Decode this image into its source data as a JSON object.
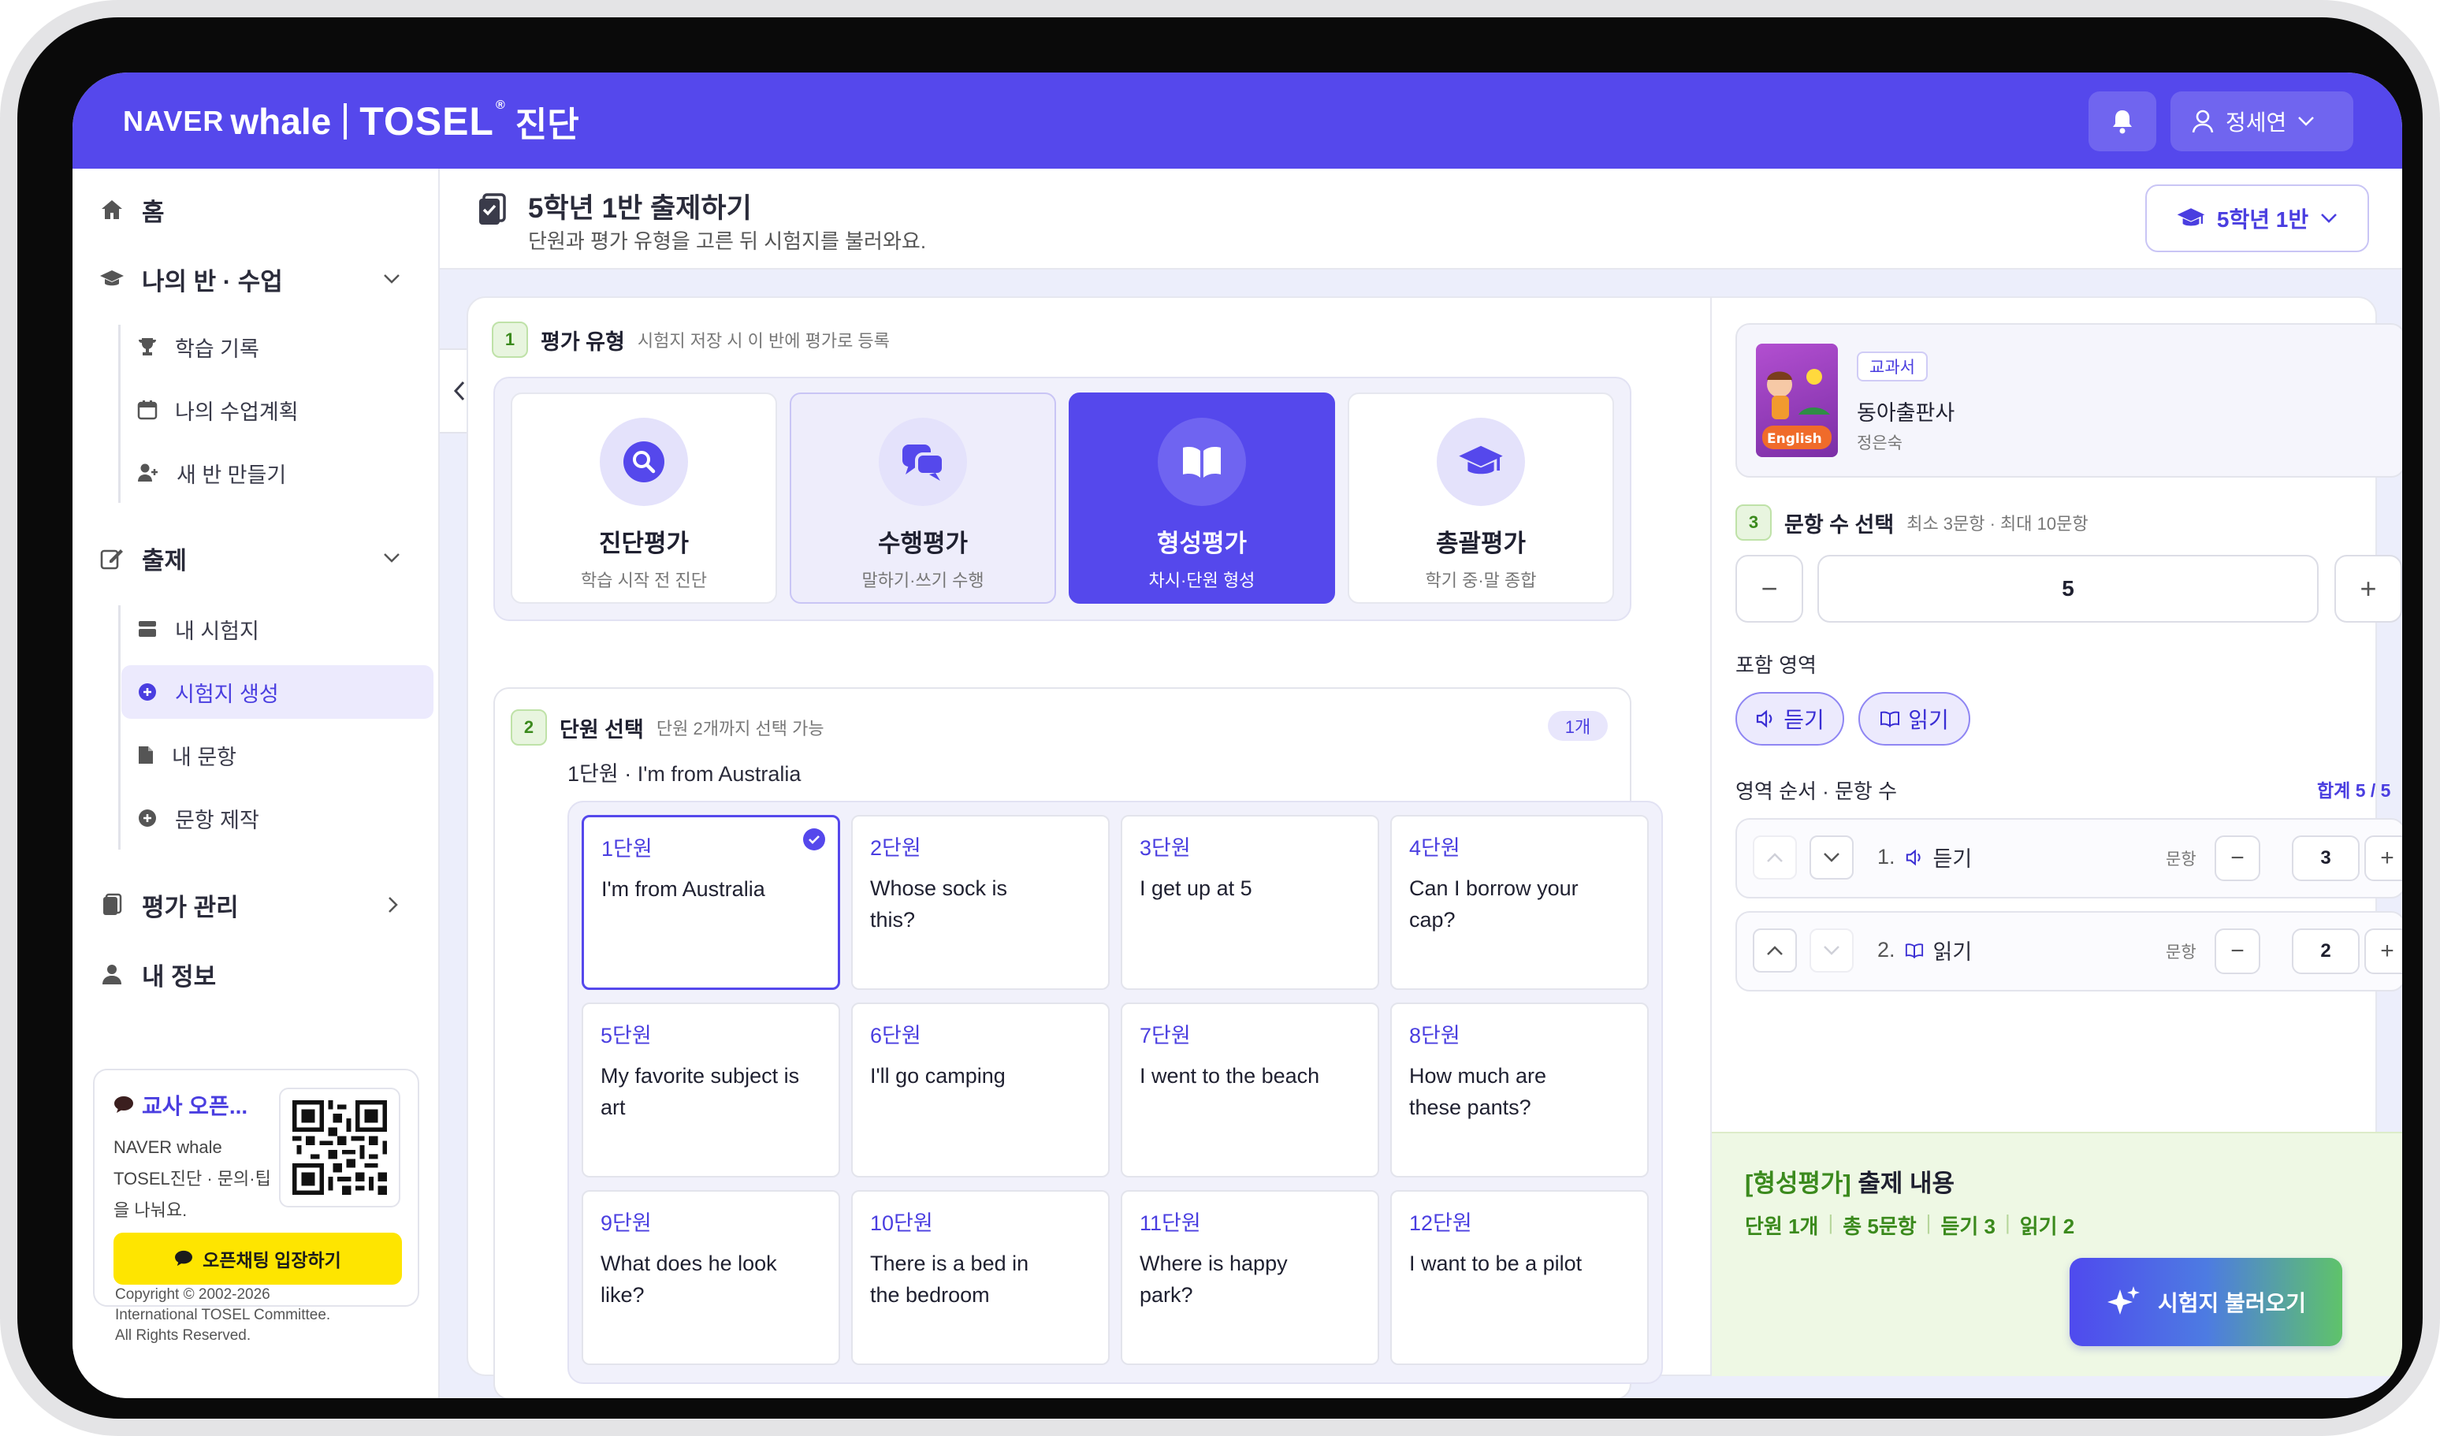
{
  "header": {
    "logo_naver": "NAVER",
    "logo_whale": "whale",
    "logo_tosel": "TOSEL",
    "logo_reg": "®",
    "logo_suffix": "진단",
    "user_name": "정세연"
  },
  "sidebar": {
    "home": "홈",
    "my_class": "나의 반 · 수업",
    "learning_record": "학습 기록",
    "my_lesson_plan": "나의 수업계획",
    "new_class": "새 반 만들기",
    "exam_making": "출제",
    "my_exams": "내 시험지",
    "exam_create": "시험지 생성",
    "my_questions": "내 문항",
    "question_make": "문항 제작",
    "assessment": "평가 관리",
    "my_info": "내 정보",
    "promo_title": "교사 오픈...",
    "promo_desc": "NAVER whale TOSEL진단 · 문의·팁을 나눠요.",
    "kakao_button": "오픈채팅 입장하기",
    "copyright": [
      "Copyright © 2002-2026",
      "International TOSEL Committee.",
      "All Rights Reserved."
    ]
  },
  "page": {
    "title": "5학년 1반 출제하기",
    "subtitle": "단원과 평가 유형을 고른 뒤 시험지를 불러와요.",
    "class_select": "5학년 1반"
  },
  "section1": {
    "step": "1",
    "title": "평가 유형",
    "hint": "시험지 저장 시 이 반에 평가로 등록",
    "types": [
      {
        "name": "진단평가",
        "sub": "학습 시작 전 진단"
      },
      {
        "name": "수행평가",
        "sub": "말하기·쓰기 수행"
      },
      {
        "name": "형성평가",
        "sub": "차시·단원 형성"
      },
      {
        "name": "총괄평가",
        "sub": "학기 중·말 종합"
      }
    ]
  },
  "section2": {
    "step": "2",
    "title": "단원 선택",
    "hint": "단원 2개까지 선택 가능",
    "count": "1개",
    "selected_line": "1단원 · I'm from Australia",
    "units": [
      {
        "num": "1단원",
        "title": "I'm from Australia"
      },
      {
        "num": "2단원",
        "title": "Whose sock is this?"
      },
      {
        "num": "3단원",
        "title": "I get up at 5"
      },
      {
        "num": "4단원",
        "title": "Can I borrow your cap?"
      },
      {
        "num": "5단원",
        "title": "My favorite subject is art"
      },
      {
        "num": "6단원",
        "title": "I'll go camping"
      },
      {
        "num": "7단원",
        "title": "I went to the beach"
      },
      {
        "num": "8단원",
        "title": "How much are these pants?"
      },
      {
        "num": "9단원",
        "title": "What does he look like?"
      },
      {
        "num": "10단원",
        "title": "There is a bed in the bedroom"
      },
      {
        "num": "11단원",
        "title": "Where is happy park?"
      },
      {
        "num": "12단원",
        "title": "I want to be a pilot"
      }
    ]
  },
  "book": {
    "tag": "교과서",
    "publisher": "동아출판사",
    "author": "정은숙",
    "cover_text": "English"
  },
  "section3": {
    "step": "3",
    "title": "문항 수 선택",
    "hint": "최소 3문항 · 최대 10문항",
    "value": "5",
    "minus": "−",
    "plus": "+"
  },
  "areas": {
    "label": "포함 영역",
    "listening": "듣기",
    "reading": "읽기"
  },
  "order": {
    "label": "영역 순서 · 문항 수",
    "total": "합계 5 / 5",
    "rows": [
      {
        "no": "1.",
        "name": "듣기",
        "unit": "문항",
        "value": "3"
      },
      {
        "no": "2.",
        "name": "읽기",
        "unit": "문항",
        "value": "2"
      }
    ]
  },
  "summary": {
    "bracket": "[형성평가]",
    "title": " 출제 내용",
    "items": [
      "단원 1개",
      "총 5문항",
      "듣기 3",
      "읽기 2"
    ],
    "sep": "|"
  },
  "load_button": "시험지 불러오기"
}
